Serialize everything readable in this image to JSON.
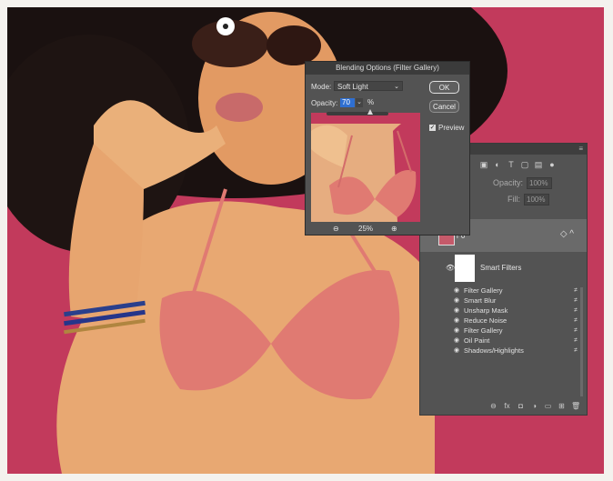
{
  "dialog": {
    "title": "Blending Options (Filter Gallery)",
    "mode_label": "Mode:",
    "mode_value": "Soft Light",
    "opacity_label": "Opacity:",
    "opacity_value": "70",
    "opacity_unit": "%",
    "opacity_level": 0.7,
    "ok_label": "OK",
    "cancel_label": "Cancel",
    "preview_label": "Preview",
    "zoom_value": "25%"
  },
  "layers_panel": {
    "opacity_label": "Opacity:",
    "opacity_value": "100%",
    "fill_label": "Fill:",
    "fill_value": "100%",
    "layer_name": "r 0",
    "smart_filters_label": "Smart Filters",
    "filters": [
      {
        "label": "Filter Gallery"
      },
      {
        "label": "Smart Blur"
      },
      {
        "label": "Unsharp Mask"
      },
      {
        "label": "Reduce Noise"
      },
      {
        "label": "Filter Gallery"
      },
      {
        "label": "Oil Paint"
      },
      {
        "label": "Shadows/Highlights"
      }
    ]
  },
  "colors": {
    "background_pink": "#c23a5c",
    "panel_gray": "#535353",
    "selection_blue": "#2f6fd1"
  }
}
